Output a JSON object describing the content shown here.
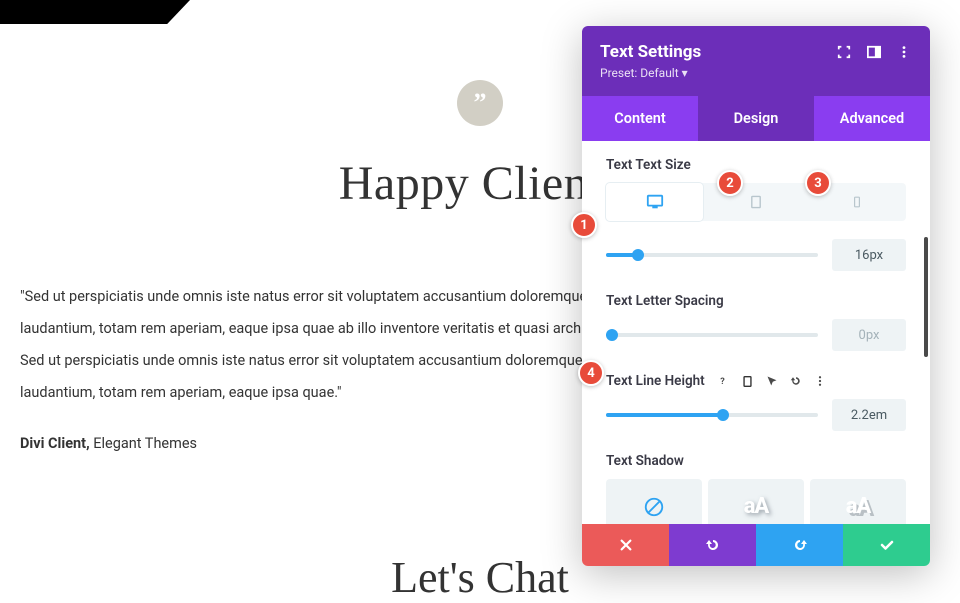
{
  "page": {
    "heading": "Happy Clients",
    "body": "\"Sed ut perspiciatis unde omnis iste natus error sit voluptatem accusantium doloremque laudantium, totam rem aperiam, eaque ipsa quae ab illo inventore veritatis et quasi architecto. Sed ut perspiciatis unde omnis iste natus error sit voluptatem accusantium doloremque laudantium, totam rem aperiam, eaque ipsa quae.\"",
    "attribution_name": "Divi Client,",
    "attribution_role": " Elegant Themes",
    "heading2": "Let's Chat"
  },
  "panel": {
    "title": "Text Settings",
    "preset": "Preset: Default ▾",
    "tabs": {
      "content": "Content",
      "design": "Design",
      "advanced": "Advanced"
    },
    "controls": {
      "text_size": {
        "label": "Text Text Size",
        "value": "16px",
        "slider_pct": 15
      },
      "letter_spacing": {
        "label": "Text Letter Spacing",
        "value": "0px",
        "slider_pct": 3
      },
      "line_height": {
        "label": "Text Line Height",
        "value": "2.2em",
        "slider_pct": 55
      },
      "text_shadow": {
        "label": "Text Shadow",
        "sample": "aA"
      }
    }
  },
  "badges": {
    "b1": "1",
    "b2": "2",
    "b3": "3",
    "b4": "4"
  }
}
